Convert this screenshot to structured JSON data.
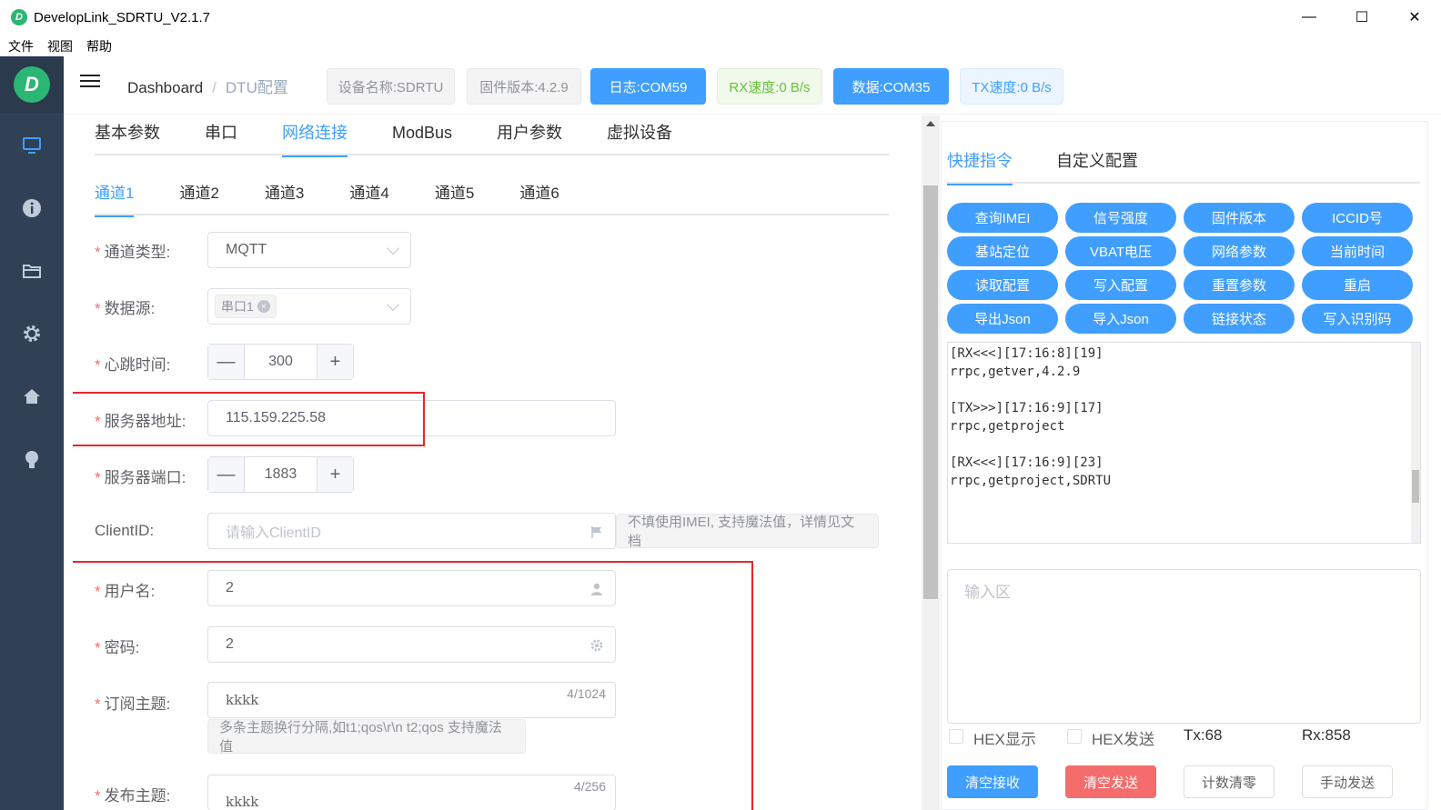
{
  "window": {
    "title": "DevelopLink_SDRTU_V2.1.7",
    "logo_letter": "D",
    "minimize": "—",
    "maximize": "☐",
    "close": "✕"
  },
  "menu": [
    "文件",
    "视图",
    "帮助"
  ],
  "sidebar": {
    "logo_letter": "D",
    "icons": [
      "monitor-icon",
      "info-icon",
      "folder-icon",
      "gear-icon",
      "home-icon",
      "lightbulb-icon"
    ]
  },
  "header": {
    "breadcrumb_root": "Dashboard",
    "breadcrumb_sep": "/",
    "breadcrumb_current": "DTU配置",
    "device_name": "设备名称:SDRTU",
    "firmware": "固件版本:4.2.9",
    "log_port": "日志:COM59",
    "rx_speed": "RX速度:0 B/s",
    "data_port": "数据:COM35",
    "tx_speed": "TX速度:0 B/s"
  },
  "main_tabs": [
    "基本参数",
    "串口",
    "网络连接",
    "ModBus",
    "用户参数",
    "虚拟设备"
  ],
  "main_tab_active": 2,
  "channel_tabs": [
    "通道1",
    "通道2",
    "通道3",
    "通道4",
    "通道5",
    "通道6"
  ],
  "channel_tab_active": 0,
  "form": {
    "channel_type": {
      "label": "通道类型:",
      "value": "MQTT"
    },
    "data_source": {
      "label": "数据源:",
      "tag": "串口1",
      "tag_close": "×"
    },
    "heartbeat": {
      "label": "心跳时间:",
      "value": "300",
      "minus": "—",
      "plus": "+"
    },
    "server_addr": {
      "label": "服务器地址:",
      "value": "115.159.225.58"
    },
    "server_port": {
      "label": "服务器端口:",
      "value": "1883",
      "minus": "—",
      "plus": "+"
    },
    "client_id": {
      "label": "ClientID:",
      "placeholder": "请输入ClientID",
      "hint": "不填使用IMEI, 支持魔法值，详情见文档"
    },
    "username": {
      "label": "用户名:",
      "value": "2"
    },
    "password": {
      "label": "密码:",
      "value": "2"
    },
    "subscribe": {
      "label": "订阅主题:",
      "value": "kkkk",
      "counter": "4/1024",
      "hint": "多条主题换行分隔,如t1;qos\\r\\n t2;qos 支持魔法值"
    },
    "publish": {
      "label": "发布主题:",
      "value": "kkkk",
      "counter": "4/256"
    },
    "required_mark": "*"
  },
  "right_tabs": [
    "快捷指令",
    "自定义配置"
  ],
  "right_tab_active": 0,
  "quick_buttons": [
    "查询IMEI",
    "信号强度",
    "固件版本",
    "ICCID号",
    "基站定位",
    "VBAT电压",
    "网络参数",
    "当前时间",
    "读取配置",
    "写入配置",
    "重置参数",
    "重启",
    "导出Json",
    "导入Json",
    "链接状态",
    "写入识别码"
  ],
  "log_lines": [
    "[RX<<<][17:16:8][19]",
    "rrpc,getver,4.2.9",
    "",
    "[TX>>>][17:16:9][17]",
    "rrpc,getproject",
    "",
    "[RX<<<][17:16:9][23]",
    "rrpc,getproject,SDRTU"
  ],
  "input_area_placeholder": "输入区",
  "options": {
    "hex_display": "HEX显示",
    "hex_send": "HEX发送",
    "tx": "Tx:68",
    "rx": "Rx:858"
  },
  "actions": {
    "clear_rx": "清空接收",
    "clear_tx": "清空发送",
    "reset_count": "计数清零",
    "manual_send": "手动发送"
  },
  "colors": {
    "primary": "#409eff",
    "danger": "#f56c6c",
    "sidebar": "#304156",
    "highlight": "#e8262a",
    "logo": "#2bb673"
  }
}
